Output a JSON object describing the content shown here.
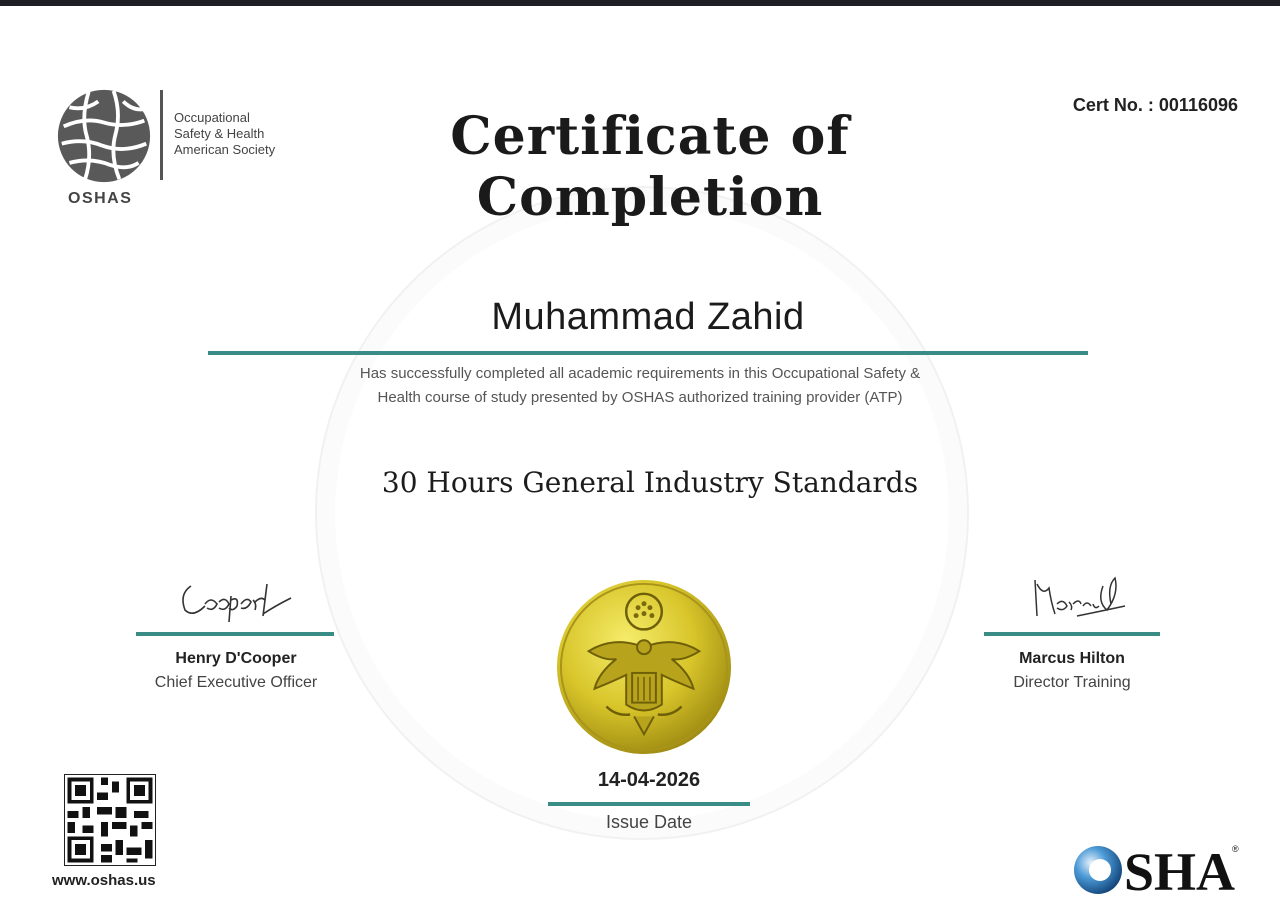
{
  "header": {
    "org_lines": [
      "Occupational",
      "Safety & Health",
      "American Society"
    ],
    "org_abbr": "OSHAS",
    "cert_no": "Cert No. : 00116096",
    "title": "Certificate of Completion"
  },
  "recipient": "Muhammad Zahid",
  "description_lines": [
    "Has successfully completed all academic requirements in this Occupational Safety &",
    "Health course of study presented by OSHAS authorized training provider (ATP)"
  ],
  "course": "30 Hours General Industry Standards",
  "signatories": [
    {
      "signature": "Cooper",
      "name": "Henry D'Cooper",
      "role": "Chief Executive Officer"
    },
    {
      "signature": "Marcus",
      "name": "Marcus Hilton",
      "role": "Director Training"
    }
  ],
  "issue": {
    "date": "14-04-2026",
    "label": "Issue Date"
  },
  "footer": {
    "website": "www.oshas.us",
    "logo_text": "OSHA"
  },
  "colors": {
    "accent": "#3a8d86",
    "seal_gold": "#d8c52a",
    "osha_blue": "#1f6fb2"
  },
  "icons": [
    "globe-logo-icon",
    "qr-code-icon",
    "seal-icon",
    "osha-logo-icon"
  ]
}
